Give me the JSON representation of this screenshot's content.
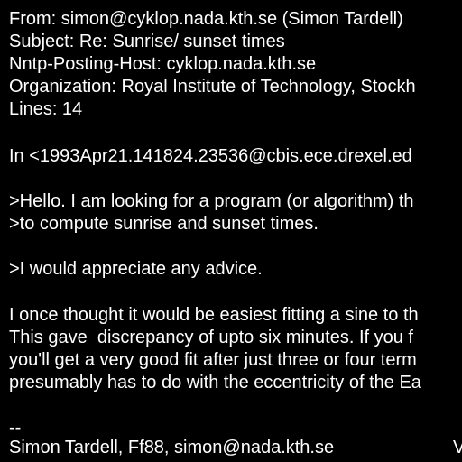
{
  "colors": {
    "background": "#000000",
    "text": "#ffffff"
  },
  "header": {
    "from": "From: simon@cyklop.nada.kth.se (Simon Tardell)",
    "subject": "Subject: Re: Sunrise/ sunset times",
    "posting_host": "Nntp-Posting-Host: cyklop.nada.kth.se",
    "organization": "Organization: Royal Institute of Technology, Stockh",
    "lines": "Lines: 14"
  },
  "body": {
    "attribution": "In <1993Apr21.141824.23536@cbis.ece.drexel.ed",
    "quote_1": ">Hello. I am looking for a program (or algorithm) th",
    "quote_2": ">to compute sunrise and sunset times.",
    "quote_3": ">I would appreciate any advice.",
    "reply_1": "I once thought it would be easiest fitting a sine to th",
    "reply_2": "This gave  discrepancy of upto six minutes. If you f",
    "reply_3": "you'll get a very good fit after just three or four term",
    "reply_4": "presumably has to do with the eccentricity of the Ea"
  },
  "signature": {
    "separator": "--",
    "line": "Simon Tardell, Ff88, simon@nada.kth.se",
    "right_fragment": "V"
  }
}
